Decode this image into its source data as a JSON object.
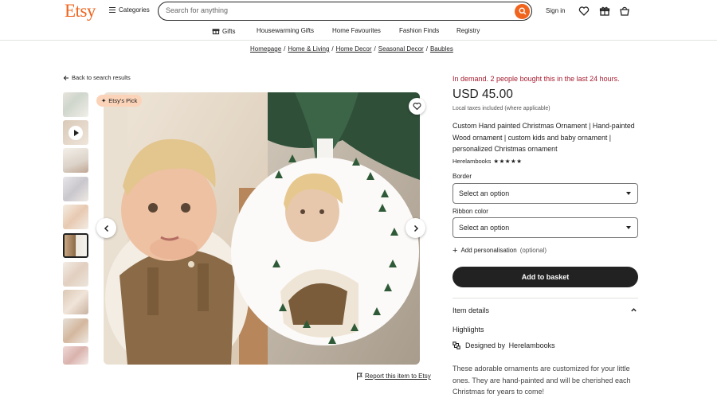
{
  "header": {
    "logo": "Etsy",
    "categories_label": "Categories",
    "search_placeholder": "Search for anything",
    "signin_label": "Sign in"
  },
  "nav": {
    "items": [
      "Gifts",
      "Housewarming Gifts",
      "Home Favourites",
      "Fashion Finds",
      "Registry"
    ]
  },
  "breadcrumb": [
    "Homepage",
    "Home & Living",
    "Home Decor",
    "Seasonal Decor",
    "Baubles"
  ],
  "back_label": "Back to search results",
  "gallery": {
    "badge": "Etsy's Pick",
    "thumbnail_count": 10,
    "active_thumbnail": 6,
    "report_label": "Report this item to Etsy"
  },
  "product": {
    "demand": "In demand. 2 people bought this in the last 24 hours.",
    "price": "USD 45.00",
    "tax_note": "Local taxes included (where applicable)",
    "title": "Custom Hand painted Christmas Ornament | Hand-painted Wood ornament | custom kids and baby ornament | personalized Christmas ornament",
    "shop_name": "Herelambooks",
    "stars": "★★★★★",
    "rating": 5
  },
  "options": {
    "border_label": "Border",
    "border_value": "Select an option",
    "ribbon_label": "Ribbon color",
    "ribbon_value": "Select an option"
  },
  "personalisation": {
    "label": "Add personalisation",
    "optional": "(optional)"
  },
  "basket_label": "Add to basket",
  "details": {
    "heading": "Item details",
    "highlights": "Highlights",
    "designed_by": "Designed by",
    "designer": "Herelambooks",
    "description": "These adorable ornaments are customized for your little ones. They are hand-painted and will be cherished each Christmas for years to come!"
  },
  "colors": {
    "brand": "#F1641E",
    "demand": "#A61A2E",
    "button": "#222222",
    "badge": "#FBD3B8"
  }
}
